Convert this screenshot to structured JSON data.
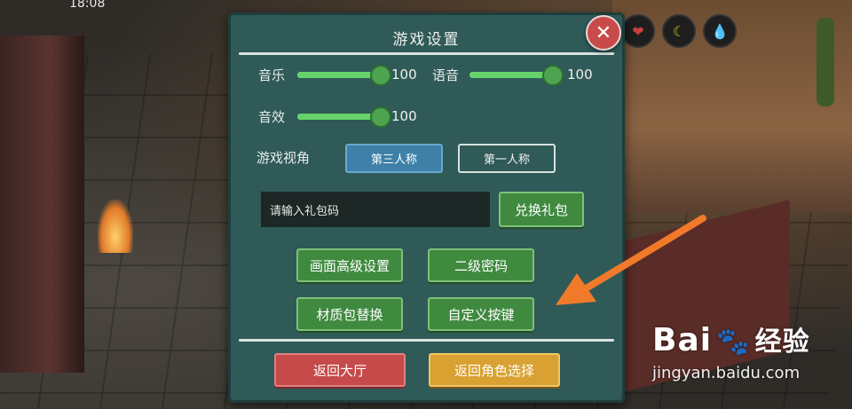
{
  "status_bar": {
    "time": "18:08"
  },
  "settings": {
    "title": "游戏设置",
    "close_symbol": "✕",
    "music": {
      "label": "音乐",
      "value": 100
    },
    "voice": {
      "label": "语音",
      "value": 100
    },
    "sfx": {
      "label": "音效",
      "value": 100
    },
    "view": {
      "label": "游戏视角",
      "options": [
        "第三人称",
        "第一人称"
      ],
      "selected": "第三人称"
    },
    "gift": {
      "placeholder": "请输入礼包码",
      "redeem_label": "兑换礼包"
    },
    "buttons": {
      "graphics_label": "画面高级设置",
      "secondary_password_label": "二级密码",
      "texture_pack_label": "材质包替换",
      "custom_keys_label": "自定义按键",
      "back_lobby_label": "返回大厅",
      "back_character_label": "返回角色选择"
    }
  },
  "hud": {
    "icons": [
      "heart-icon",
      "stamina-icon",
      "water-drop-icon"
    ],
    "glyphs": [
      "❤",
      "☾",
      "💧"
    ]
  },
  "watermark": {
    "brand": "Bai",
    "brand_suffix": "经验",
    "url": "jingyan.baidu.com"
  },
  "colors": {
    "panel": "#2f5a58",
    "slider_fill": "#65d36a",
    "arrow": "#f07a2a"
  }
}
